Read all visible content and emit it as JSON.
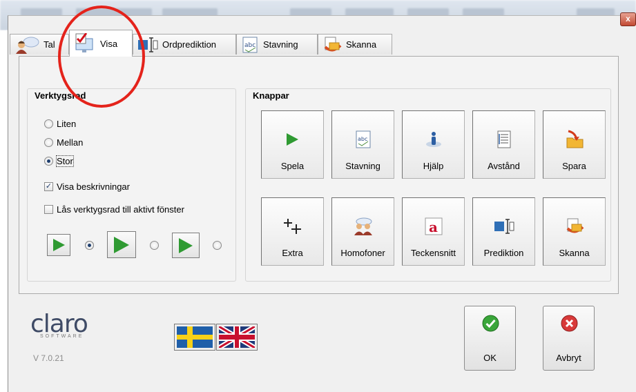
{
  "tabs": [
    {
      "label": "Tal",
      "icon": "speaker-person-icon"
    },
    {
      "label": "Visa",
      "icon": "monitor-check-icon"
    },
    {
      "label": "Ordprediktion",
      "icon": "word-prediction-icon"
    },
    {
      "label": "Stavning",
      "icon": "spelling-abc-icon"
    },
    {
      "label": "Skanna",
      "icon": "scan-icon"
    }
  ],
  "toolbar_group": {
    "title": "Verktygsrad",
    "sizes": [
      "Liten",
      "Mellan",
      "Stor"
    ],
    "selected_size": "Stor",
    "show_descriptions_label": "Visa beskrivningar",
    "show_descriptions_checked": true,
    "lock_label": "Lås verktygsrad till aktivt fönster",
    "lock_checked": false
  },
  "buttons_group": {
    "title": "Knappar",
    "buttons": [
      {
        "label": "Spela",
        "icon": "play-icon"
      },
      {
        "label": "Stavning",
        "icon": "spelling-icon"
      },
      {
        "label": "Hjälp",
        "icon": "info-icon"
      },
      {
        "label": "Avstånd",
        "icon": "spacing-icon"
      },
      {
        "label": "Spara",
        "icon": "save-folder-icon"
      },
      {
        "label": "Extra",
        "icon": "extra-plus-icon"
      },
      {
        "label": "Homofoner",
        "icon": "homophones-icon"
      },
      {
        "label": "Teckensnitt",
        "icon": "font-icon"
      },
      {
        "label": "Prediktion",
        "icon": "prediction-icon"
      },
      {
        "label": "Skanna",
        "icon": "scan-icon"
      }
    ]
  },
  "branding": {
    "logo": "claro",
    "logo_sub": "SOFTWARE",
    "version": "V 7.0.21"
  },
  "languages": [
    "Swedish flag",
    "UK flag"
  ],
  "dialog_buttons": {
    "ok": "OK",
    "cancel": "Avbryt"
  },
  "close_glyph": "x",
  "colors": {
    "annotation": "#e4231b",
    "play": "#2f9a32",
    "ok": "#3aa63a",
    "cancel": "#d83a3a"
  }
}
